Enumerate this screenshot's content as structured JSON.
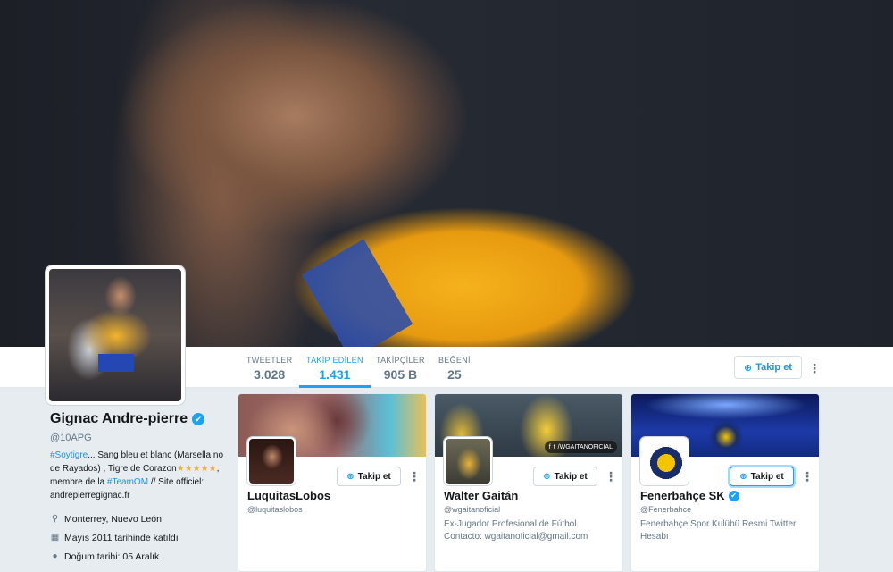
{
  "profile": {
    "name": "Gignac Andre-pierre",
    "handle": "@10APG",
    "bio_link1": "#Soytigre",
    "bio_text1": "... Sang bleu et blanc (Marsella no de Rayados) , Tigre de Corazon",
    "bio_stars": "★★★★★",
    "bio_text2": ", membre de la ",
    "bio_link2": "#TeamOM",
    "bio_text3": " // Site officiel: andrepierregignac.fr",
    "location": "Monterrey, Nuevo León",
    "joined": "Mayıs 2011 tarihinde katıldı",
    "birthday": "Doğum tarihi: 05 Aralık"
  },
  "nav": {
    "stats": [
      {
        "label": "TWEETLER",
        "value": "3.028"
      },
      {
        "label": "TAKİP EDİLEN",
        "value": "1.431"
      },
      {
        "label": "TAKİPÇİLER",
        "value": "905 B"
      },
      {
        "label": "BEĞENİ",
        "value": "25"
      }
    ],
    "follow_label": "Takip et",
    "more": "⋮"
  },
  "cards": [
    {
      "name": "LuquitasLobos",
      "handle": "@luquitaslobos",
      "bio": "",
      "follow_label": "Takip et",
      "verified": false
    },
    {
      "name": "Walter Gaitán",
      "handle": "@wgaitanoficial",
      "bio": "Ex-Jugador Profesional de Fútbol. Contacto: wgaitanoficial@gmail.com",
      "follow_label": "Takip et",
      "verified": false,
      "cover_tag": "/WGAITANOFICIAL"
    },
    {
      "name": "Fenerbahçe SK",
      "handle": "@Fenerbahce",
      "bio": "Fenerbahçe Spor Kulübü Resmi Twitter Hesabı",
      "follow_label": "Takip et",
      "verified": true
    }
  ],
  "icons": {
    "verified": "✔",
    "location": "location-pin-icon",
    "calendar": "calendar-icon",
    "balloon": "balloon-icon",
    "follow": "person-plus-icon"
  },
  "colors": {
    "accent": "#1da1f2",
    "link": "#1b95e0",
    "muted": "#657786",
    "star": "#f4ae1f"
  }
}
